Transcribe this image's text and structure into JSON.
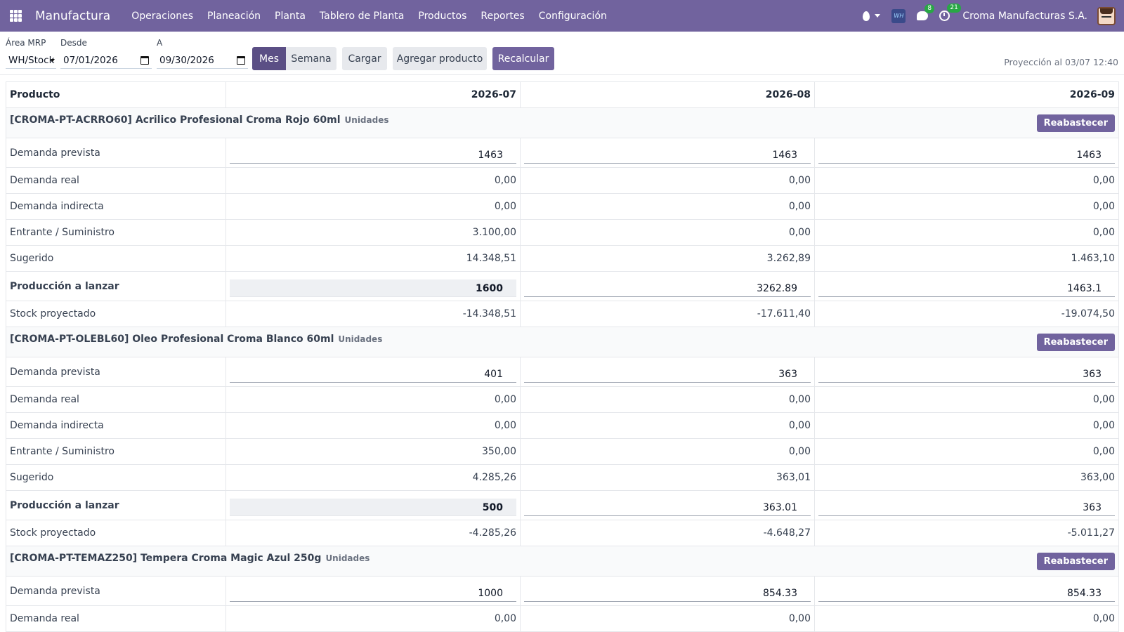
{
  "navbar": {
    "app_name": "Manufactura",
    "menu": [
      "Operaciones",
      "Planeación",
      "Planta",
      "Tablero de Planta",
      "Productos",
      "Reportes",
      "Configuración"
    ],
    "chat_badge": "8",
    "activity_badge": "21",
    "wh_logo_text": "WH",
    "company": "Croma Manufacturas S.A."
  },
  "controls": {
    "area_label": "Área MRP",
    "area_value": "WH/Stock",
    "from_label": "Desde",
    "from_value": "07/01/2026",
    "to_label": "A",
    "to_value": "09/30/2026",
    "btn_month": "Mes",
    "btn_week": "Semana",
    "btn_load": "Cargar",
    "btn_add_product": "Agregar producto",
    "btn_recalc": "Recalcular",
    "projection": "Proyección al 03/07 12:40"
  },
  "table": {
    "header_product": "Producto",
    "periods": [
      "2026-07",
      "2026-08",
      "2026-09"
    ],
    "replenish_label": "Reabastecer",
    "products": [
      {
        "name": "[CROMA-PT-ACRRO60] Acrilico Profesional Croma Rojo 60ml",
        "unit": "Unidades",
        "rows": [
          {
            "label": "Demanda prevista",
            "type": "input",
            "values": [
              "1463",
              "1463",
              "1463"
            ]
          },
          {
            "label": "Demanda real",
            "type": "num",
            "values": [
              "0,00",
              "0,00",
              "0,00"
            ]
          },
          {
            "label": "Demanda indirecta",
            "type": "num",
            "values": [
              "0,00",
              "0,00",
              "0,00"
            ]
          },
          {
            "label": "Entrante / Suministro",
            "type": "num",
            "values": [
              "3.100,00",
              "0,00",
              "0,00"
            ]
          },
          {
            "label": "Sugerido",
            "type": "num",
            "values": [
              "14.348,51",
              "3.262,89",
              "1.463,10"
            ]
          },
          {
            "label": "Producción a lanzar",
            "type": "prod",
            "values": [
              "1600",
              "3262.89",
              "1463.1"
            ]
          },
          {
            "label": "Stock proyectado",
            "type": "num",
            "values": [
              "-14.348,51",
              "-17.611,40",
              "-19.074,50"
            ]
          }
        ]
      },
      {
        "name": "[CROMA-PT-OLEBL60] Oleo Profesional Croma Blanco 60ml",
        "unit": "Unidades",
        "rows": [
          {
            "label": "Demanda prevista",
            "type": "input",
            "values": [
              "401",
              "363",
              "363"
            ]
          },
          {
            "label": "Demanda real",
            "type": "num",
            "values": [
              "0,00",
              "0,00",
              "0,00"
            ]
          },
          {
            "label": "Demanda indirecta",
            "type": "num",
            "values": [
              "0,00",
              "0,00",
              "0,00"
            ]
          },
          {
            "label": "Entrante / Suministro",
            "type": "num",
            "values": [
              "350,00",
              "0,00",
              "0,00"
            ]
          },
          {
            "label": "Sugerido",
            "type": "num",
            "values": [
              "4.285,26",
              "363,01",
              "363,00"
            ]
          },
          {
            "label": "Producción a lanzar",
            "type": "prod",
            "values": [
              "500",
              "363.01",
              "363"
            ]
          },
          {
            "label": "Stock proyectado",
            "type": "num",
            "values": [
              "-4.285,26",
              "-4.648,27",
              "-5.011,27"
            ]
          }
        ]
      },
      {
        "name": "[CROMA-PT-TEMAZ250] Tempera Croma Magic Azul 250g",
        "unit": "Unidades",
        "rows": [
          {
            "label": "Demanda prevista",
            "type": "input",
            "values": [
              "1000",
              "854.33",
              "854.33"
            ]
          },
          {
            "label": "Demanda real",
            "type": "num",
            "values": [
              "0,00",
              "0,00",
              "0,00"
            ]
          }
        ]
      }
    ]
  }
}
